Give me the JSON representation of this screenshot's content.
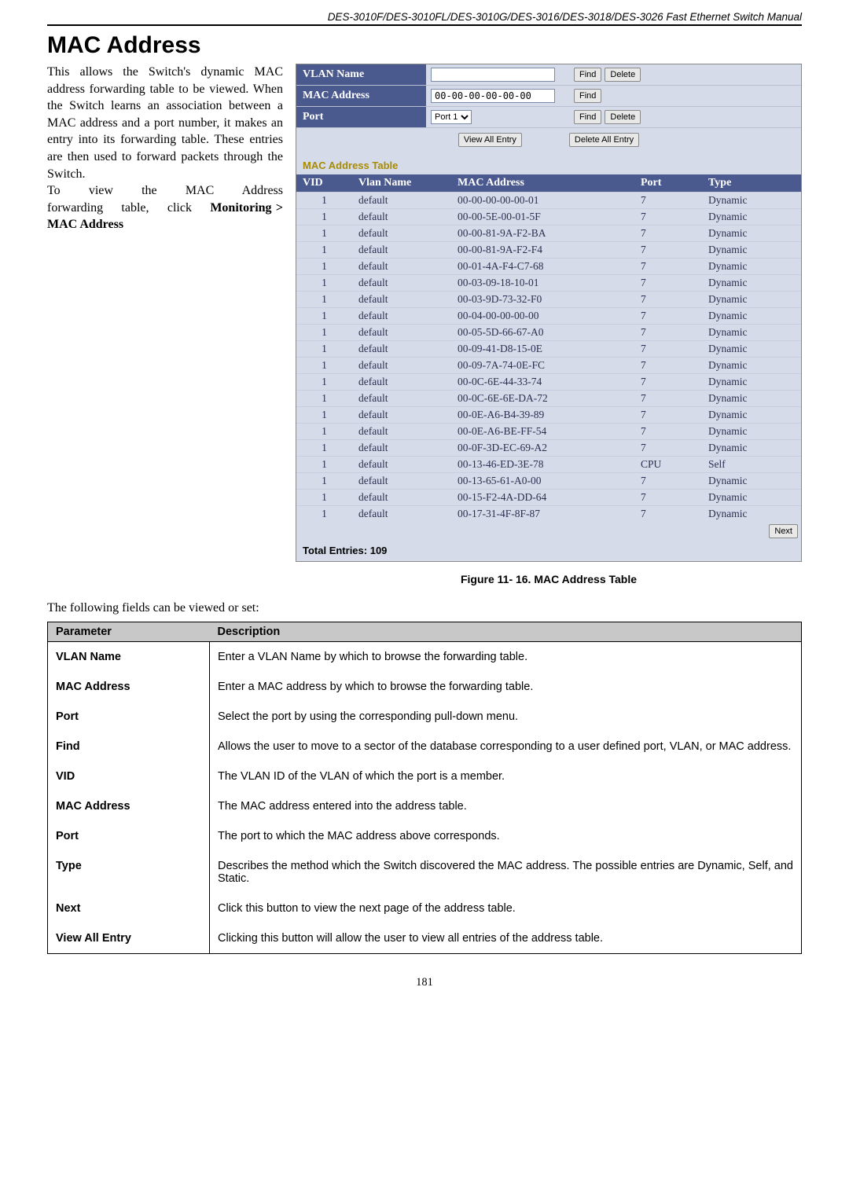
{
  "header": "DES-3010F/DES-3010FL/DES-3010G/DES-3016/DES-3018/DES-3026 Fast Ethernet Switch Manual",
  "title": "MAC Address",
  "intro": {
    "p1": "This allows the Switch's dynamic MAC address forwarding table to be viewed. When the Switch learns an association between a MAC address and a port number, it makes an entry into its forwarding table. These entries are then used to forward packets through the Switch.",
    "p2_pre": "To view the MAC Address forwarding table, click ",
    "p2_bold": "Monitoring > MAC Address"
  },
  "ui": {
    "vlan_label": "VLAN Name",
    "mac_label": "MAC Address",
    "port_label": "Port",
    "mac_value": "00-00-00-00-00-00",
    "port_value": "Port 1",
    "btn_find": "Find",
    "btn_delete": "Delete",
    "btn_view_all": "View All Entry",
    "btn_delete_all": "Delete All Entry",
    "table_title": "MAC Address Table",
    "headers": {
      "vid": "VID",
      "vlan": "Vlan Name",
      "mac": "MAC Address",
      "port": "Port",
      "type": "Type"
    },
    "rows": [
      {
        "vid": "1",
        "vlan": "default",
        "mac": "00-00-00-00-00-01",
        "port": "7",
        "type": "Dynamic"
      },
      {
        "vid": "1",
        "vlan": "default",
        "mac": "00-00-5E-00-01-5F",
        "port": "7",
        "type": "Dynamic"
      },
      {
        "vid": "1",
        "vlan": "default",
        "mac": "00-00-81-9A-F2-BA",
        "port": "7",
        "type": "Dynamic"
      },
      {
        "vid": "1",
        "vlan": "default",
        "mac": "00-00-81-9A-F2-F4",
        "port": "7",
        "type": "Dynamic"
      },
      {
        "vid": "1",
        "vlan": "default",
        "mac": "00-01-4A-F4-C7-68",
        "port": "7",
        "type": "Dynamic"
      },
      {
        "vid": "1",
        "vlan": "default",
        "mac": "00-03-09-18-10-01",
        "port": "7",
        "type": "Dynamic"
      },
      {
        "vid": "1",
        "vlan": "default",
        "mac": "00-03-9D-73-32-F0",
        "port": "7",
        "type": "Dynamic"
      },
      {
        "vid": "1",
        "vlan": "default",
        "mac": "00-04-00-00-00-00",
        "port": "7",
        "type": "Dynamic"
      },
      {
        "vid": "1",
        "vlan": "default",
        "mac": "00-05-5D-66-67-A0",
        "port": "7",
        "type": "Dynamic"
      },
      {
        "vid": "1",
        "vlan": "default",
        "mac": "00-09-41-D8-15-0E",
        "port": "7",
        "type": "Dynamic"
      },
      {
        "vid": "1",
        "vlan": "default",
        "mac": "00-09-7A-74-0E-FC",
        "port": "7",
        "type": "Dynamic"
      },
      {
        "vid": "1",
        "vlan": "default",
        "mac": "00-0C-6E-44-33-74",
        "port": "7",
        "type": "Dynamic"
      },
      {
        "vid": "1",
        "vlan": "default",
        "mac": "00-0C-6E-6E-DA-72",
        "port": "7",
        "type": "Dynamic"
      },
      {
        "vid": "1",
        "vlan": "default",
        "mac": "00-0E-A6-B4-39-89",
        "port": "7",
        "type": "Dynamic"
      },
      {
        "vid": "1",
        "vlan": "default",
        "mac": "00-0E-A6-BE-FF-54",
        "port": "7",
        "type": "Dynamic"
      },
      {
        "vid": "1",
        "vlan": "default",
        "mac": "00-0F-3D-EC-69-A2",
        "port": "7",
        "type": "Dynamic"
      },
      {
        "vid": "1",
        "vlan": "default",
        "mac": "00-13-46-ED-3E-78",
        "port": "CPU",
        "type": "Self"
      },
      {
        "vid": "1",
        "vlan": "default",
        "mac": "00-13-65-61-A0-00",
        "port": "7",
        "type": "Dynamic"
      },
      {
        "vid": "1",
        "vlan": "default",
        "mac": "00-15-F2-4A-DD-64",
        "port": "7",
        "type": "Dynamic"
      },
      {
        "vid": "1",
        "vlan": "default",
        "mac": "00-17-31-4F-8F-87",
        "port": "7",
        "type": "Dynamic"
      }
    ],
    "btn_next": "Next",
    "total": "Total Entries: 109"
  },
  "figure_caption": "Figure 11- 16. MAC Address Table",
  "subtext": "The following fields can be viewed or set:",
  "param_headers": {
    "param": "Parameter",
    "desc": "Description"
  },
  "params": [
    {
      "name": "VLAN Name",
      "desc": "Enter a VLAN Name by which to browse the forwarding table."
    },
    {
      "name": "MAC Address",
      "desc": "Enter a MAC address by which to browse the forwarding table."
    },
    {
      "name": "Port",
      "desc": "Select the port by using the corresponding pull-down menu."
    },
    {
      "name": "Find",
      "desc": "Allows the user to move to a sector of the database corresponding to a user defined port, VLAN, or MAC address."
    },
    {
      "name": "VID",
      "desc": "The VLAN ID of the VLAN of which the port is a member."
    },
    {
      "name": "MAC Address",
      "desc": "The MAC address entered into the address table."
    },
    {
      "name": "Port",
      "desc": "The port to which the MAC address above corresponds."
    },
    {
      "name": "Type",
      "desc": "Describes the method which the Switch discovered the MAC address. The possible entries are Dynamic, Self, and Static."
    },
    {
      "name": "Next",
      "desc": "Click this button to view the next page of the address table."
    },
    {
      "name": "View All Entry",
      "desc": "Clicking this button will allow the user to view all entries of the address table."
    }
  ],
  "page_no": "181"
}
